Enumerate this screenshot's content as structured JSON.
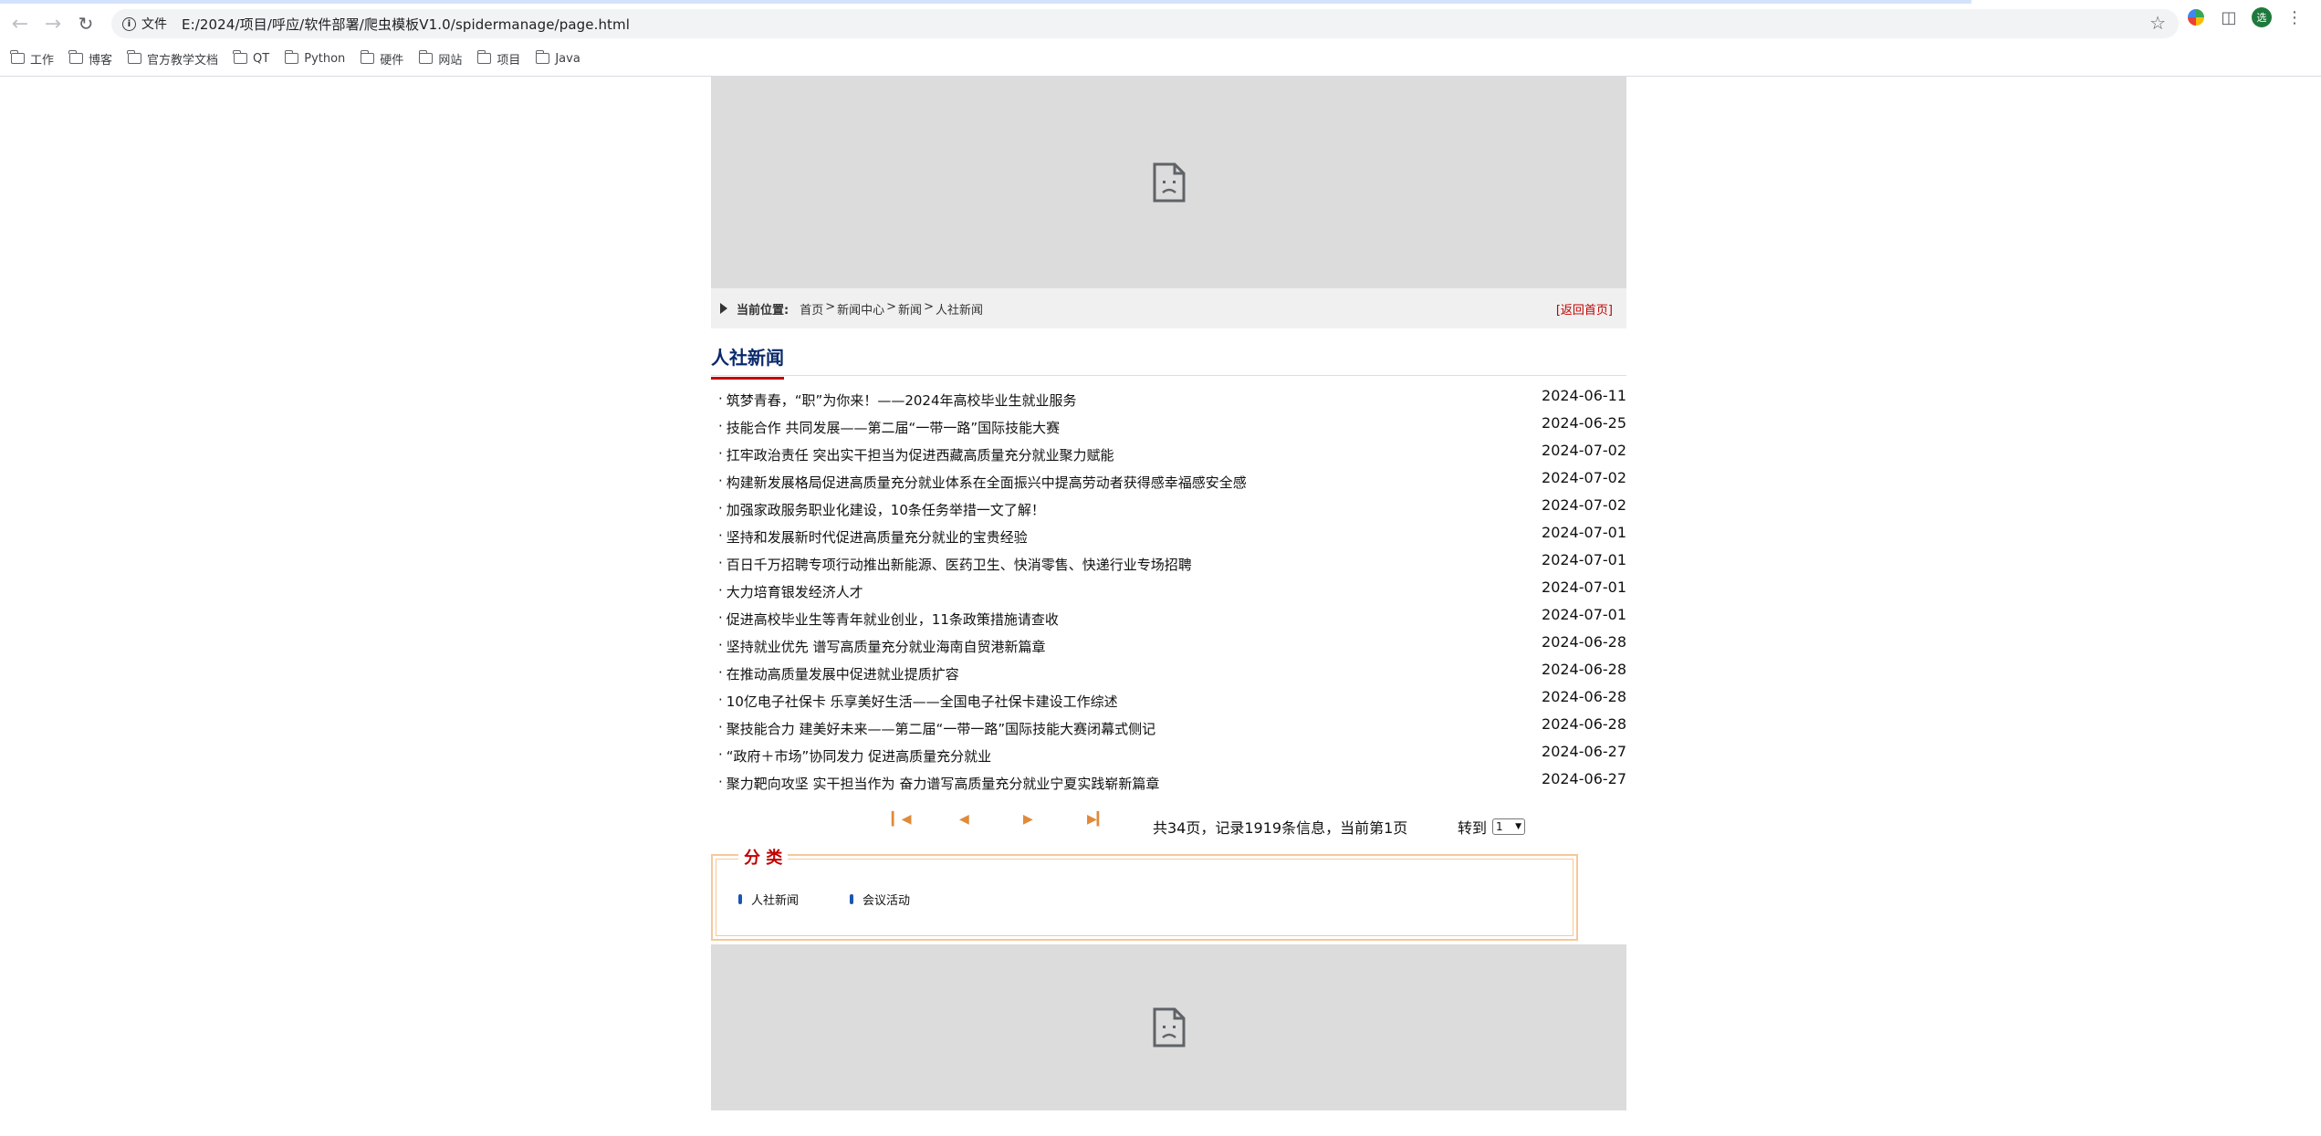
{
  "browser": {
    "site_info_label": "文件",
    "url": "E:/2024/项目/呼应/软件部署/爬虫模板V1.0/spidermanage/page.html",
    "profile_initial": "选",
    "bookmarks": [
      "工作",
      "博客",
      "官方教学文档",
      "QT",
      "Python",
      "硬件",
      "网站",
      "项目",
      "Java"
    ]
  },
  "breadcrumb": {
    "label": "当前位置:",
    "items": [
      "首页",
      "新闻中心",
      "新闻",
      "人社新闻"
    ],
    "separator": ">",
    "back_home": "[返回首页]"
  },
  "section": {
    "title": "人社新闻"
  },
  "news": [
    {
      "title": "筑梦青春，“职”为你来！——2024年高校毕业生就业服务",
      "date": "2024-06-11"
    },
    {
      "title": "技能合作 共同发展——第二届“一带一路”国际技能大赛",
      "date": "2024-06-25"
    },
    {
      "title": "扛牢政治责任 突出实干担当为促进西藏高质量充分就业聚力赋能",
      "date": "2024-07-02"
    },
    {
      "title": "构建新发展格局促进高质量充分就业体系在全面振兴中提高劳动者获得感幸福感安全感",
      "date": "2024-07-02"
    },
    {
      "title": "加强家政服务职业化建设，10条任务举措一文了解！",
      "date": "2024-07-02"
    },
    {
      "title": "坚持和发展新时代促进高质量充分就业的宝贵经验",
      "date": "2024-07-01"
    },
    {
      "title": "百日千万招聘专项行动推出新能源、医药卫生、快消零售、快递行业专场招聘",
      "date": "2024-07-01"
    },
    {
      "title": "大力培育银发经济人才",
      "date": "2024-07-01"
    },
    {
      "title": "促进高校毕业生等青年就业创业，11条政策措施请查收",
      "date": "2024-07-01"
    },
    {
      "title": "坚持就业优先 谱写高质量充分就业海南自贸港新篇章",
      "date": "2024-06-28"
    },
    {
      "title": "在推动高质量发展中促进就业提质扩容",
      "date": "2024-06-28"
    },
    {
      "title": "10亿电子社保卡 乐享美好生活——全国电子社保卡建设工作综述",
      "date": "2024-06-28"
    },
    {
      "title": "聚技能合力 建美好未来——第二届“一带一路”国际技能大赛闭幕式侧记",
      "date": "2024-06-28"
    },
    {
      "title": "“政府＋市场”协同发力 促进高质量充分就业",
      "date": "2024-06-27"
    },
    {
      "title": "聚力靶向攻坚 实干担当作为 奋力谱写高质量充分就业宁夏实践崭新篇章",
      "date": "2024-06-27"
    }
  ],
  "pager": {
    "info": "共34页，记录1919条信息，当前第1页",
    "goto_label": "转到",
    "selected_page": "1"
  },
  "category": {
    "legend": "分 类",
    "items": [
      "人社新闻",
      "会议活动"
    ]
  },
  "colors": {
    "accent_red": "#c00000",
    "title_blue": "#0a2a6b",
    "category_border": "#f6c89a",
    "pager_orange": "#e08a3a"
  }
}
